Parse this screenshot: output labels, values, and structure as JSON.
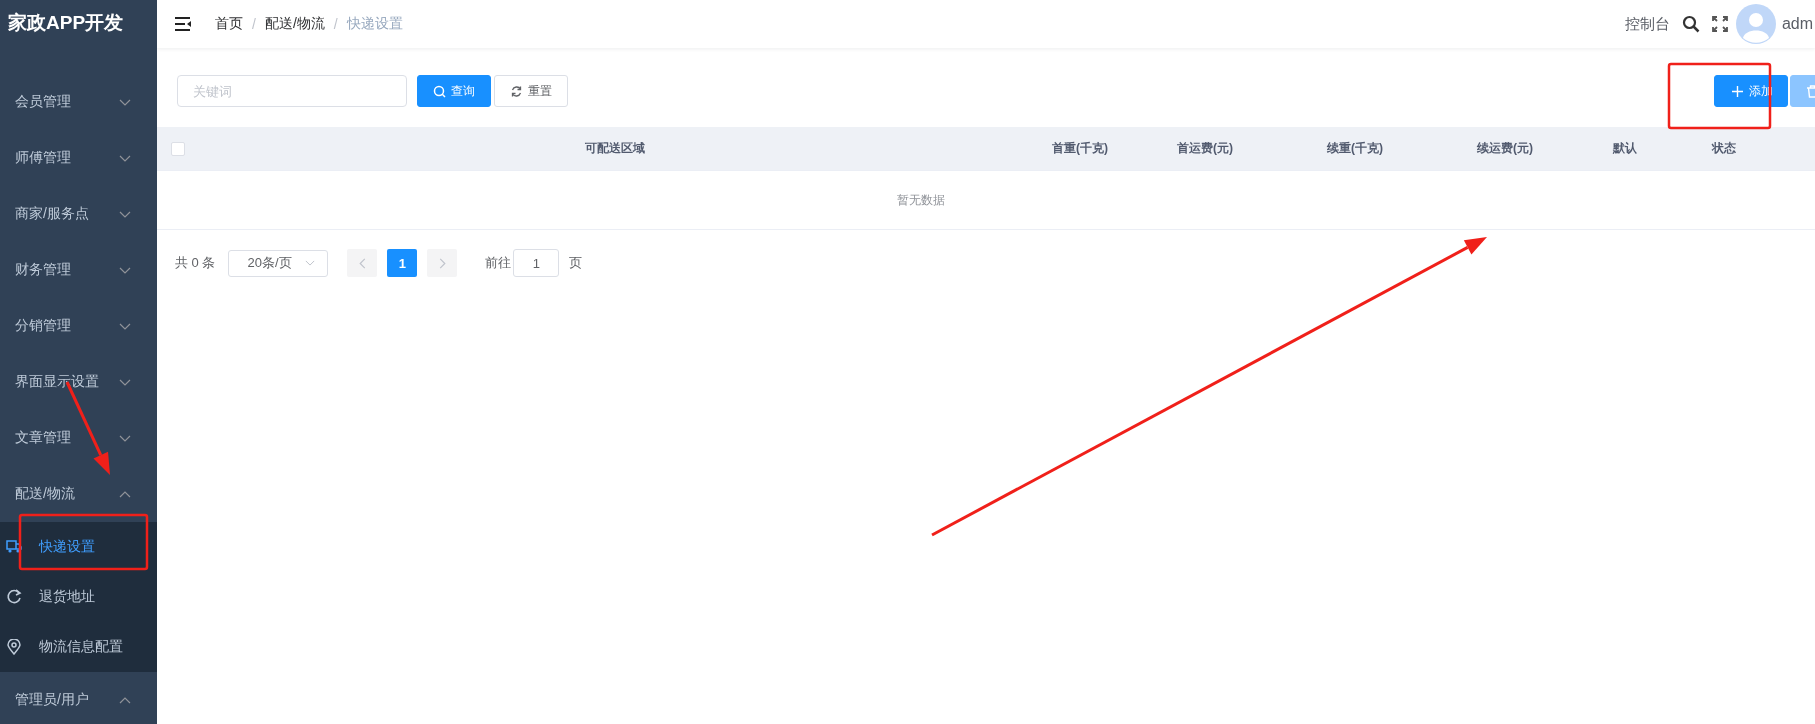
{
  "sidebar": {
    "logo": "家政APP开发",
    "items": [
      {
        "label": "会员管理",
        "expanded": false
      },
      {
        "label": "师傅管理",
        "expanded": false
      },
      {
        "label": "商家/服务点",
        "expanded": false
      },
      {
        "label": "财务管理",
        "expanded": false
      },
      {
        "label": "分销管理",
        "expanded": false
      },
      {
        "label": "界面显示设置",
        "expanded": false
      },
      {
        "label": "文章管理",
        "expanded": false
      },
      {
        "label": "配送/物流",
        "expanded": true,
        "children": [
          {
            "label": "快递设置",
            "kind": "truck",
            "selected": true
          },
          {
            "label": "退货地址",
            "kind": "refresh",
            "selected": false
          },
          {
            "label": "物流信息配置",
            "kind": "pin",
            "selected": false
          }
        ]
      },
      {
        "label": "管理员/用户",
        "expanded": true
      }
    ]
  },
  "header": {
    "breadcrumb": [
      "首页",
      "配送/物流",
      "快递设置"
    ],
    "separator": "/",
    "console_link": "控制台",
    "user": "adm"
  },
  "toolbar": {
    "search": {
      "placeholder": "关键词"
    },
    "buttons": [
      {
        "label": "查询",
        "kind": "search"
      },
      {
        "label": "重置",
        "kind": "reset"
      }
    ],
    "actions": [
      {
        "label": "添加",
        "kind": "add",
        "disabled": false
      },
      {
        "kind": "delete",
        "disabled": true
      }
    ]
  },
  "table": {
    "select_all": {
      "checked": false
    },
    "columns": [
      "可配送区域",
      "首重(千克)",
      "首运费(元)",
      "续重(千克)",
      "续运费(元)",
      "默认",
      "状态"
    ],
    "empty_text": "暂无数据"
  },
  "pagination": {
    "total": "共 0 条",
    "page_size": "20条/页",
    "pages": [
      {
        "label": "1",
        "selected": true
      }
    ],
    "jump_label": "前往",
    "jump_value": "1",
    "jump_suffix": "页"
  },
  "annotations": [
    {
      "kind": "box"
    },
    {
      "kind": "box"
    },
    {
      "kind": "arrow"
    },
    {
      "kind": "arrow"
    }
  ]
}
